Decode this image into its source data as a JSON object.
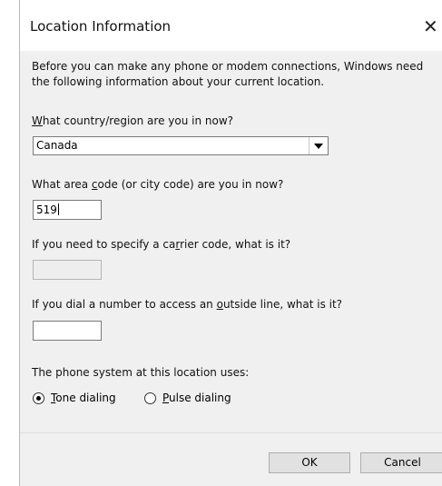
{
  "dialog": {
    "title": "Location Information",
    "close_symbol": "✕"
  },
  "intro": {
    "line1": "Before you can make any phone or modem connections, Windows need",
    "line2": "the following information about your current location."
  },
  "country": {
    "label_prefix": "",
    "label_access": "W",
    "label_rest": "hat country/region are you in now?",
    "value": "Canada"
  },
  "area_code": {
    "label_prefix": "What area ",
    "label_access": "c",
    "label_rest": "ode (or city code) are you in now?",
    "value": "519"
  },
  "carrier_code": {
    "label_prefix": "If you need to specify a ca",
    "label_access": "r",
    "label_rest": "rier code, what is it?",
    "value": ""
  },
  "outside_line": {
    "label_prefix": "If you dial a number to access an ",
    "label_access": "o",
    "label_rest": "utside line, what is it?",
    "value": ""
  },
  "phone_system": {
    "label": "The phone system at this location uses:",
    "tone": {
      "access": "T",
      "rest": "one dialing",
      "checked": true
    },
    "pulse": {
      "access": "P",
      "rest": "ulse dialing",
      "checked": false
    }
  },
  "buttons": {
    "ok_label": "OK",
    "cancel_label": "Cancel"
  },
  "icons": {
    "close": "close-icon",
    "dropdown": "chevron-down-icon"
  },
  "colors": {
    "titlebar": "#ffffff",
    "body": "#f0f0f0",
    "button_face": "#e1e1e1"
  }
}
